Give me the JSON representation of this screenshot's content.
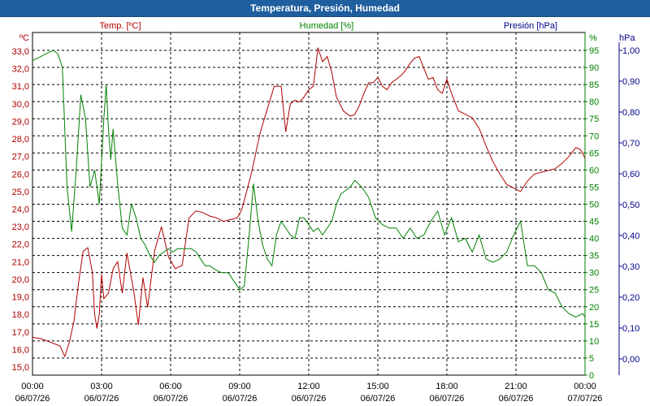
{
  "window": {
    "title": "Temperatura, Presión, Humedad"
  },
  "colors": {
    "temperature": "#b00000",
    "humidity": "#008000",
    "pressure": "#00008b",
    "title_bg": "#1f5f9f"
  },
  "chart_data": {
    "type": "line",
    "title": "Temperatura, Presión, Humedad",
    "grid": true,
    "x_ticks": [
      {
        "time": "00:00",
        "date": "06/07/26"
      },
      {
        "time": "03:00",
        "date": "06/07/26"
      },
      {
        "time": "06:00",
        "date": "06/07/26"
      },
      {
        "time": "09:00",
        "date": "06/07/26"
      },
      {
        "time": "12:00",
        "date": "06/07/26"
      },
      {
        "time": "15:00",
        "date": "06/07/26"
      },
      {
        "time": "18:00",
        "date": "06/07/26"
      },
      {
        "time": "21:00",
        "date": "06/07/26"
      },
      {
        "time": "00:00",
        "date": "07/07/26"
      }
    ],
    "axes": {
      "temperature": {
        "label": "Temp. [ºC]",
        "unit": "ºC",
        "ylim": [
          15.0,
          33.0
        ],
        "ticks": [
          "15,0",
          "16,0",
          "17,0",
          "18,0",
          "19,0",
          "20,0",
          "21,0",
          "22,0",
          "23,0",
          "24,0",
          "25,0",
          "26,0",
          "27,0",
          "28,0",
          "29,0",
          "30,0",
          "31,0",
          "32,0",
          "33,0"
        ]
      },
      "humidity": {
        "label": "Humedad [%]",
        "unit": "%",
        "ylim": [
          0,
          95
        ],
        "ticks": [
          "0",
          "5",
          "10",
          "15",
          "20",
          "25",
          "30",
          "35",
          "40",
          "45",
          "50",
          "55",
          "60",
          "65",
          "70",
          "75",
          "80",
          "85",
          "90",
          "95"
        ]
      },
      "pressure": {
        "label": "Presión [hPa]",
        "unit": "hPa",
        "ylim": [
          0.0,
          1.0
        ],
        "ticks": [
          "0,00",
          "0,10",
          "0,20",
          "0,30",
          "0,40",
          "0,50",
          "0,60",
          "0,70",
          "0,80",
          "0,90",
          "1,00"
        ]
      }
    },
    "series": [
      {
        "name": "Temp. [ºC]",
        "axis": "temperature",
        "x_hours": [
          0,
          0.4,
          0.8,
          1.2,
          1.4,
          1.6,
          1.8,
          2.0,
          2.2,
          2.4,
          2.6,
          2.7,
          2.8,
          2.9,
          3.0,
          3.1,
          3.3,
          3.5,
          3.7,
          3.9,
          4.1,
          4.4,
          4.6,
          4.8,
          5.0,
          5.3,
          5.6,
          5.9,
          6.2,
          6.5,
          6.8,
          7.1,
          7.4,
          7.7,
          8.0,
          8.3,
          8.6,
          8.9,
          9.1,
          9.3,
          9.5,
          9.7,
          9.9,
          10.2,
          10.5,
          10.8,
          11.0,
          11.2,
          11.4,
          11.6,
          11.8,
          12.0,
          12.2,
          12.4,
          12.6,
          12.8,
          13.0,
          13.2,
          13.5,
          13.8,
          14.0,
          14.2,
          14.4,
          14.6,
          14.8,
          15.0,
          15.2,
          15.4,
          15.6,
          15.8,
          16.0,
          16.2,
          16.4,
          16.6,
          16.8,
          17.0,
          17.2,
          17.4,
          17.6,
          17.8,
          18.0,
          18.2,
          18.5,
          18.8,
          19.1,
          19.4,
          19.7,
          20.0,
          20.3,
          20.6,
          20.9,
          21.2,
          21.5,
          21.8,
          22.1,
          22.4,
          22.7,
          23.0,
          23.3,
          23.6,
          23.8,
          24.0
        ],
        "y": [
          16.7,
          16.6,
          16.4,
          16.2,
          15.6,
          16.4,
          17.6,
          19.8,
          21.6,
          21.8,
          20.4,
          18.0,
          17.2,
          18.0,
          20.3,
          18.9,
          19.2,
          20.6,
          21.0,
          19.2,
          21.5,
          19.3,
          17.4,
          20.1,
          18.4,
          21.6,
          23.0,
          21.3,
          20.6,
          20.8,
          23.5,
          23.9,
          23.8,
          23.6,
          23.5,
          23.3,
          23.4,
          23.5,
          24.0,
          25.0,
          26.0,
          27.2,
          28.4,
          29.7,
          31.0,
          31.0,
          28.4,
          30.0,
          30.2,
          30.1,
          30.4,
          30.8,
          31.0,
          33.2,
          32.4,
          32.7,
          31.8,
          30.4,
          29.6,
          29.3,
          29.4,
          29.9,
          30.6,
          31.2,
          31.2,
          31.5,
          31.0,
          30.8,
          31.2,
          31.4,
          31.6,
          31.9,
          32.3,
          32.6,
          32.7,
          32.0,
          31.4,
          31.5,
          30.8,
          30.6,
          31.4,
          30.6,
          29.6,
          29.4,
          29.2,
          28.6,
          27.6,
          26.7,
          26.0,
          25.4,
          25.2,
          25.0,
          25.6,
          26.0,
          26.1,
          26.2,
          26.3,
          26.6,
          27.0,
          27.5,
          27.4,
          26.9
        ]
      },
      {
        "name": "Humedad [%]",
        "axis": "humidity",
        "x_hours": [
          0,
          0.3,
          0.6,
          0.9,
          1.1,
          1.3,
          1.5,
          1.7,
          1.9,
          2.1,
          2.3,
          2.5,
          2.7,
          2.9,
          3.1,
          3.2,
          3.3,
          3.4,
          3.5,
          3.7,
          3.9,
          4.1,
          4.3,
          4.5,
          4.7,
          4.9,
          5.1,
          5.3,
          5.5,
          5.7,
          5.9,
          6.1,
          6.3,
          6.5,
          6.7,
          6.9,
          7.1,
          7.3,
          7.5,
          7.7,
          7.9,
          8.2,
          8.5,
          8.8,
          9.0,
          9.2,
          9.4,
          9.6,
          9.8,
          10.0,
          10.2,
          10.4,
          10.6,
          10.8,
          11.0,
          11.2,
          11.4,
          11.6,
          11.8,
          12.0,
          12.2,
          12.4,
          12.6,
          12.8,
          13.0,
          13.2,
          13.4,
          13.6,
          13.8,
          14.0,
          14.3,
          14.6,
          14.9,
          15.2,
          15.5,
          15.8,
          16.1,
          16.4,
          16.7,
          17.0,
          17.3,
          17.6,
          17.9,
          18.2,
          18.5,
          18.8,
          19.1,
          19.4,
          19.7,
          20.0,
          20.3,
          20.6,
          20.9,
          21.2,
          21.5,
          21.8,
          22.1,
          22.4,
          22.7,
          23.0,
          23.3,
          23.6,
          23.9,
          24.0
        ],
        "y": [
          92,
          93,
          94,
          95,
          94,
          90,
          55,
          42,
          60,
          82,
          75,
          55,
          60,
          50,
          75,
          85,
          72,
          63,
          72,
          56,
          43,
          41,
          50,
          46,
          40,
          38,
          35,
          33,
          35,
          36,
          37,
          36,
          37,
          37,
          37,
          37,
          36,
          34,
          32,
          32,
          31,
          30,
          30,
          27,
          25,
          26,
          40,
          56,
          45,
          38,
          34,
          32,
          41,
          45,
          43,
          41,
          40,
          46,
          46,
          44,
          42,
          43,
          41,
          43,
          45,
          50,
          53,
          54,
          55,
          57,
          55,
          52,
          46,
          44,
          43,
          43,
          40,
          43,
          40,
          41,
          45,
          48,
          41,
          46,
          39,
          40,
          36,
          41,
          34,
          33,
          34,
          36,
          41,
          45,
          32,
          32,
          30,
          25,
          24,
          20,
          18,
          17,
          18,
          17,
          16,
          18
        ]
      }
    ]
  }
}
